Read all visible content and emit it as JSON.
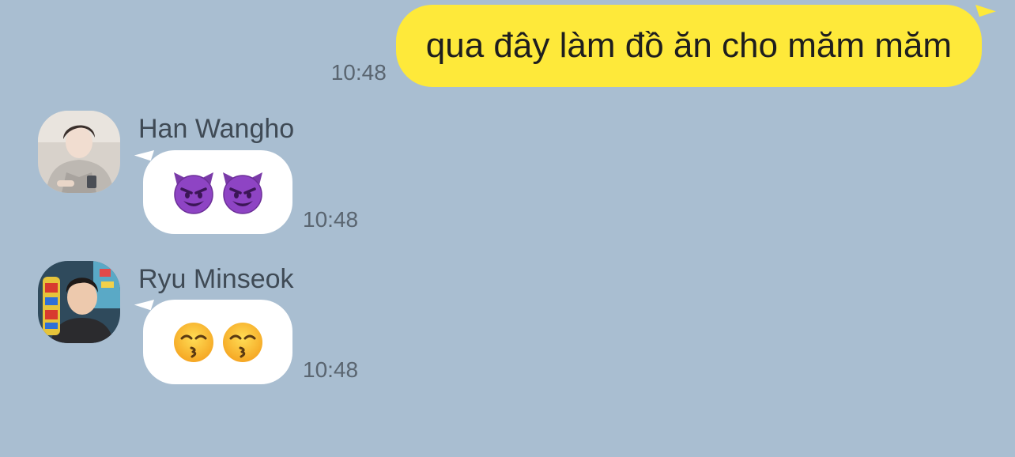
{
  "messages": [
    {
      "direction": "outgoing",
      "text": "qua đây làm đồ ăn cho măm măm",
      "time": "10:48",
      "bubble_color": "#fee93a"
    },
    {
      "direction": "incoming",
      "sender": "Han Wangho",
      "emojis": [
        "smiling-imp",
        "smiling-imp"
      ],
      "time": "10:48",
      "bubble_color": "#ffffff"
    },
    {
      "direction": "incoming",
      "sender": "Ryu Minseok",
      "emojis": [
        "kissing-smiling-eyes",
        "kissing-smiling-eyes"
      ],
      "time": "10:48",
      "bubble_color": "#ffffff"
    }
  ],
  "colors": {
    "chat_background": "#a9bed1",
    "outgoing_bubble": "#fee93a",
    "incoming_bubble": "#ffffff",
    "timestamp": "#5a6570",
    "sender_name": "#3f4a55"
  }
}
